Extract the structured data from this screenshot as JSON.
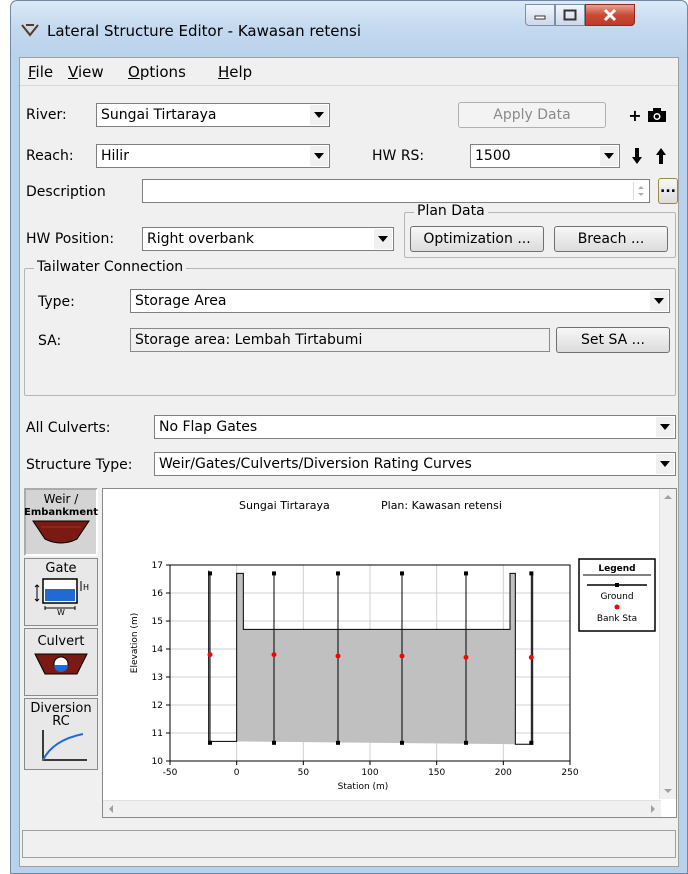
{
  "window": {
    "title": "Lateral Structure Editor - Kawasan retensi"
  },
  "menu": {
    "file": "F",
    "file_rest": "ile",
    "view": "V",
    "view_rest": "iew",
    "options": "O",
    "options_rest": "ptions",
    "help": "H",
    "help_rest": "elp"
  },
  "form": {
    "river_label": "River:",
    "river_value": "Sungai Tirtaraya",
    "apply_label": "Apply Data",
    "reach_label": "Reach:",
    "reach_value": "Hilir",
    "hwrs_label": "HW RS:",
    "hwrs_value": "1500",
    "description_label": "Description",
    "description_value": "",
    "ellipsis_label": "...",
    "hwpos_label": "HW Position:",
    "hwpos_value": "Right overbank",
    "plan_data_label": "Plan Data",
    "optimization_label": "Optimization ...",
    "breach_label": "Breach ..."
  },
  "tailwater": {
    "legend": "Tailwater Connection",
    "type_label": "Type:",
    "type_value": "Storage Area",
    "sa_label": "SA:",
    "sa_value": "Storage area: Lembah Tirtabumi",
    "set_sa_label": "Set SA ..."
  },
  "culverts": {
    "label": "All Culverts:",
    "value": "No Flap Gates"
  },
  "structure": {
    "label": "Structure Type:",
    "value": "Weir/Gates/Culverts/Diversion Rating Curves"
  },
  "side_tabs": {
    "weir_line1": "Weir /",
    "weir_line2": "Embankment",
    "gate": "Gate",
    "culvert": "Culvert",
    "diversion_line1": "Diversion",
    "diversion_line2": "RC"
  },
  "colors": {
    "ground_fill": "#c0c0c0",
    "bank_sta": "#ff0000",
    "structure_fill": "#8b1a1a",
    "gate_fill": "#1f6ad6"
  },
  "chart_data": {
    "type": "line",
    "header_left": "Sungai Tirtaraya",
    "header_right": "Plan: Kawasan retensi",
    "xlabel": "Station (m)",
    "ylabel": "Elevation (m)",
    "xlim": [
      -50,
      250
    ],
    "ylim": [
      10,
      17
    ],
    "xticks": [
      "-50",
      "0",
      "50",
      "100",
      "150",
      "200",
      "250"
    ],
    "yticks": [
      "10",
      "11",
      "12",
      "13",
      "14",
      "15",
      "16",
      "17"
    ],
    "grid": true,
    "legend_position": "right",
    "legend_title": "Legend",
    "series": [
      {
        "name": "Ground",
        "x": [
          -21,
          -21,
          0,
          0,
          5,
          5,
          205,
          205,
          209,
          209,
          222,
          222
        ],
        "y": [
          16.8,
          10.7,
          10.7,
          16.7,
          16.7,
          14.7,
          14.7,
          16.7,
          16.7,
          10.6,
          10.6,
          16.7
        ]
      },
      {
        "name": "Bank Sta",
        "x": [
          -20,
          28,
          76,
          124,
          172,
          221
        ],
        "y": [
          13.8,
          13.8,
          13.75,
          13.75,
          13.7,
          13.7
        ]
      }
    ]
  }
}
